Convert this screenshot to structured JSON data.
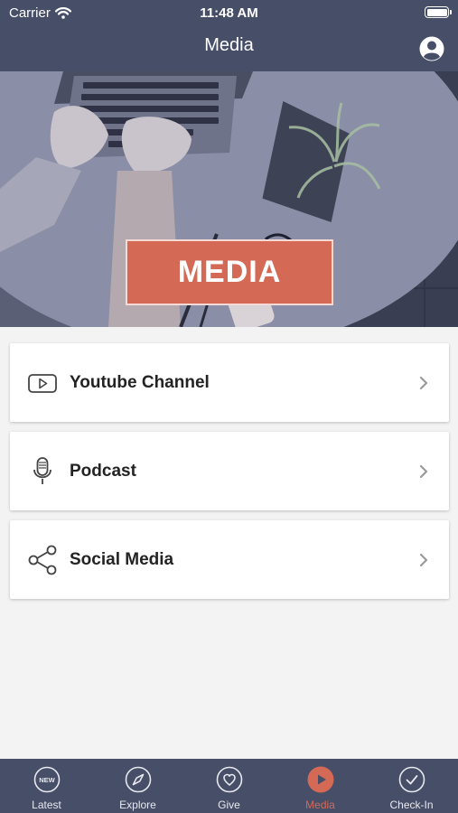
{
  "status_bar": {
    "carrier": "Carrier",
    "time": "11:48 AM"
  },
  "header": {
    "title": "Media"
  },
  "hero": {
    "badge_text": "MEDIA"
  },
  "menu": {
    "items": [
      {
        "label": "Youtube Channel",
        "icon": "youtube-icon"
      },
      {
        "label": "Podcast",
        "icon": "microphone-icon"
      },
      {
        "label": "Social Media",
        "icon": "share-icon"
      }
    ]
  },
  "tabs": {
    "items": [
      {
        "label": "Latest",
        "icon": "new-icon"
      },
      {
        "label": "Explore",
        "icon": "compass-icon"
      },
      {
        "label": "Give",
        "icon": "heart-icon"
      },
      {
        "label": "Media",
        "icon": "play-icon",
        "active": true
      },
      {
        "label": "Check-In",
        "icon": "checkmark-icon"
      }
    ],
    "new_badge_text": "NEW"
  },
  "colors": {
    "header_bg": "#474e68",
    "accent": "#d46a55",
    "background": "#f3f3f3"
  }
}
